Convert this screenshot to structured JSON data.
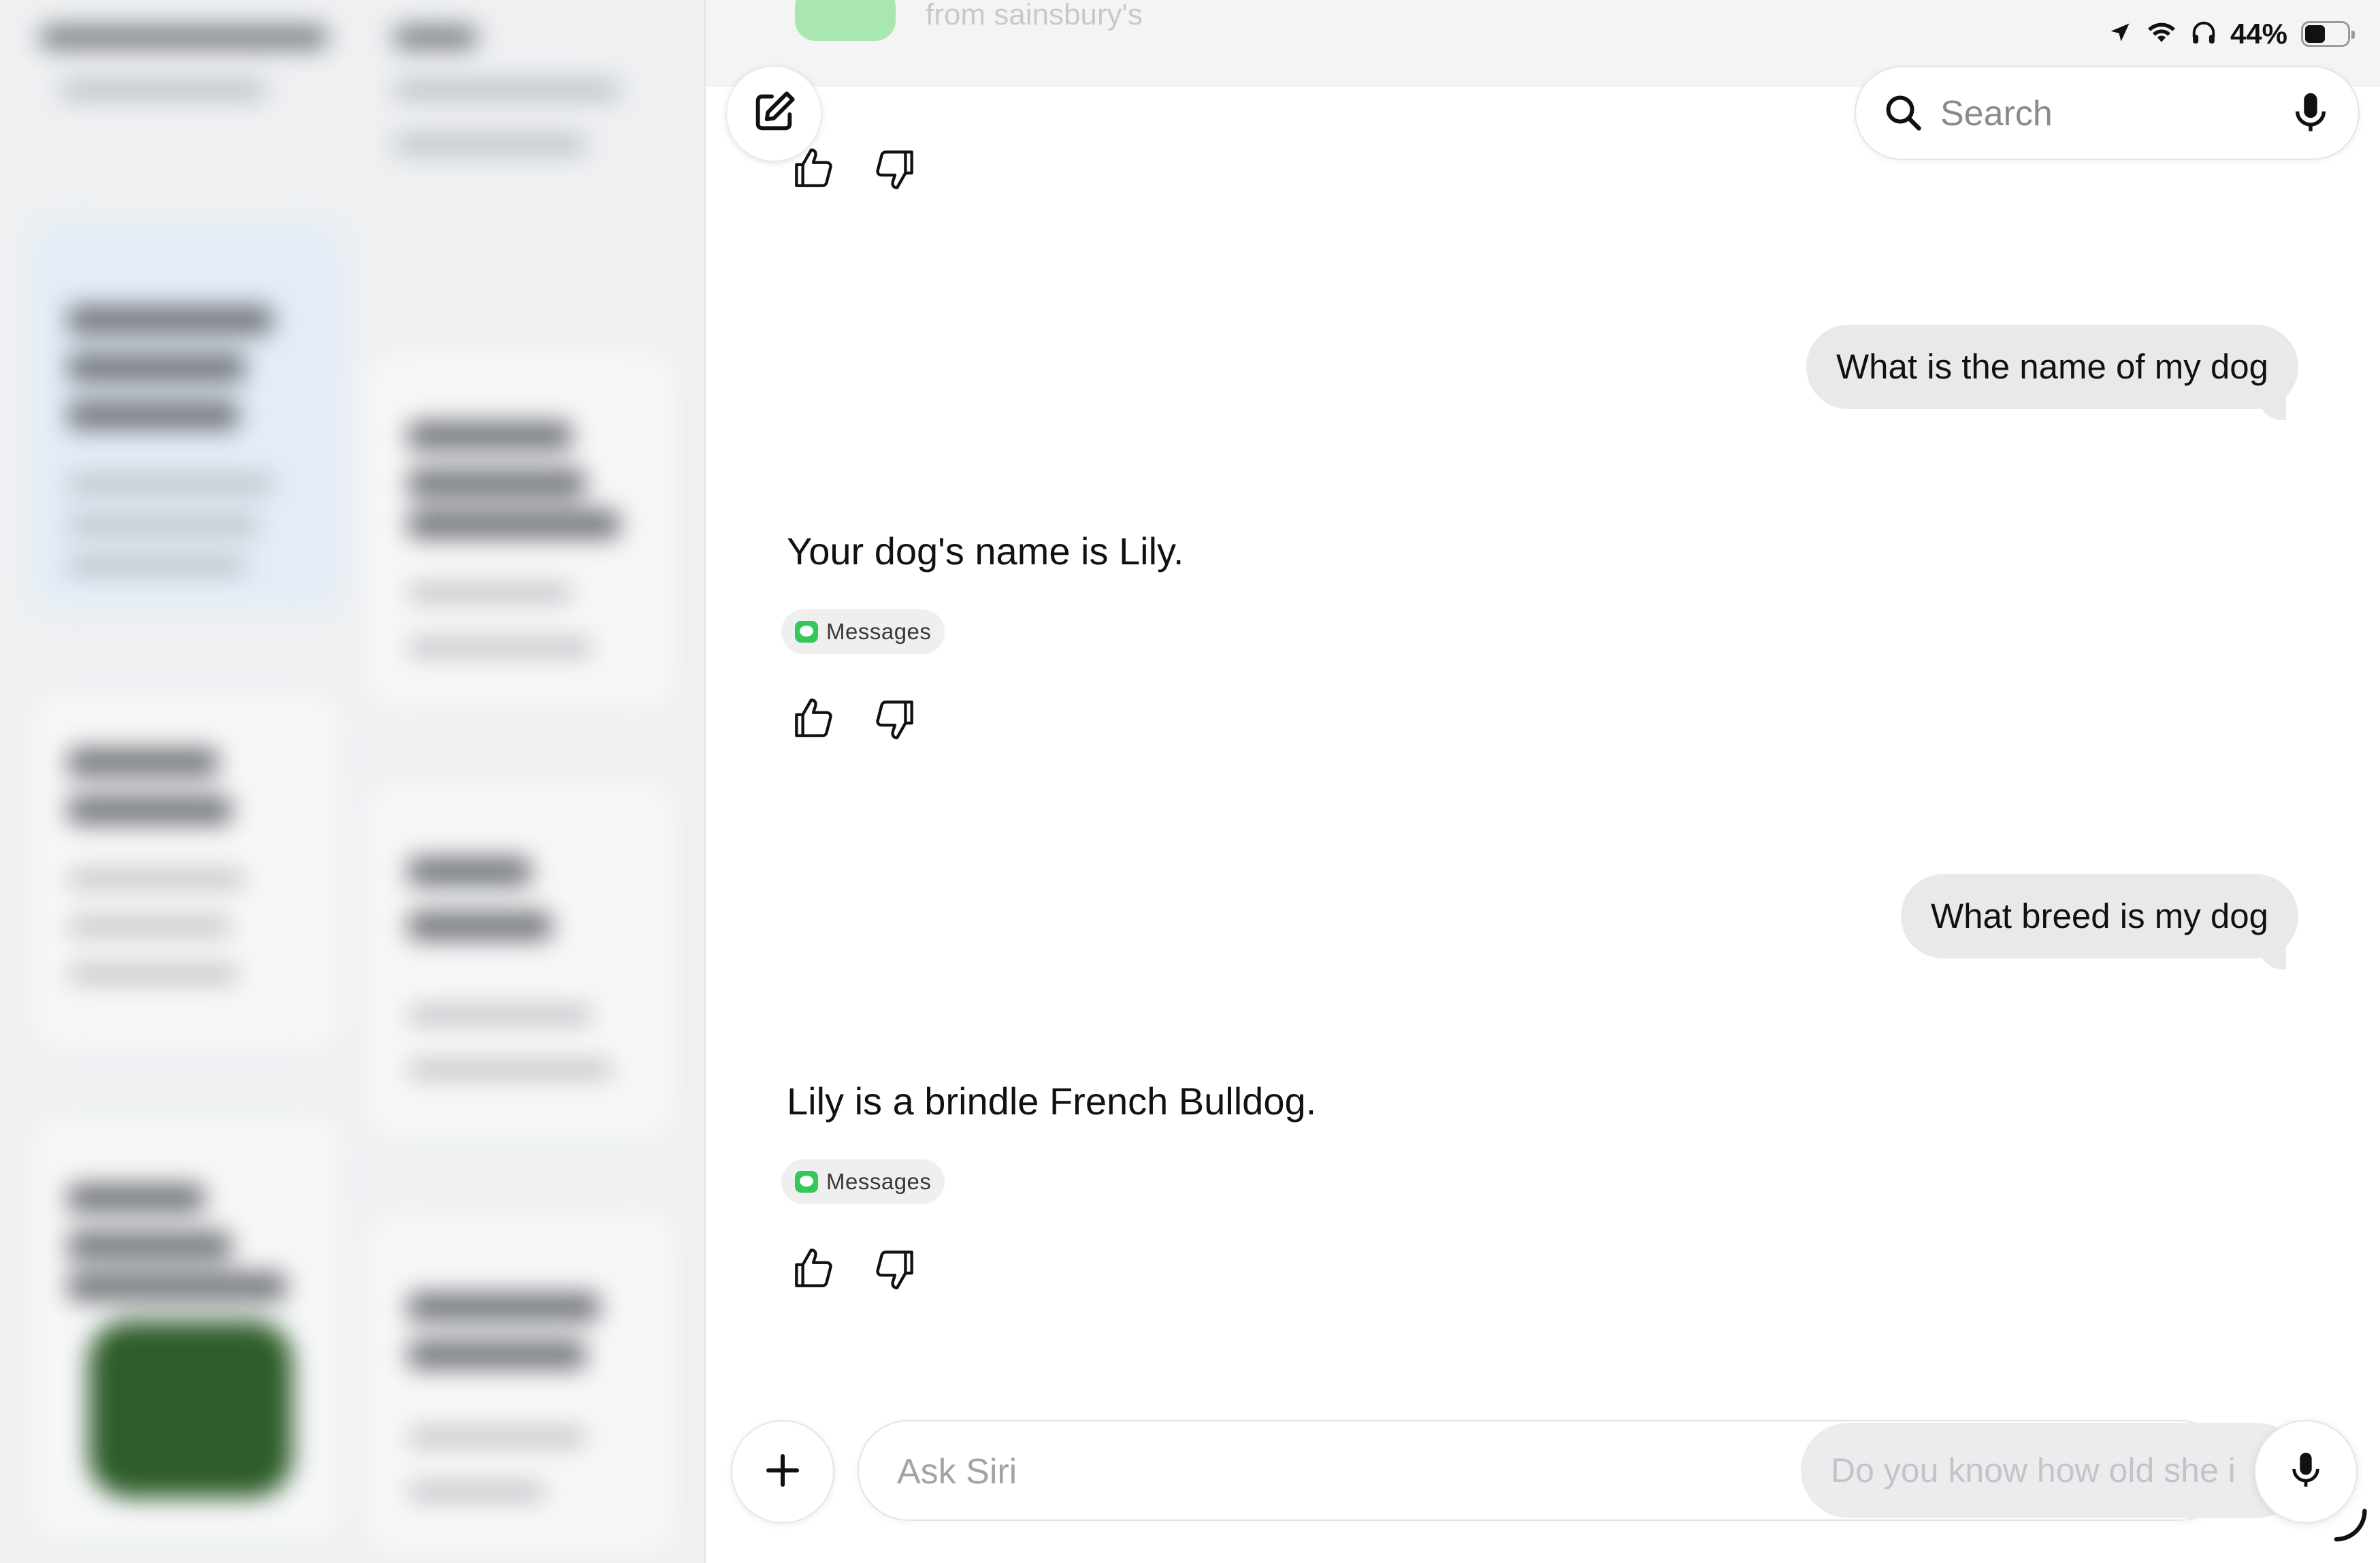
{
  "notification": {
    "text": "from sainsbury's"
  },
  "status_bar": {
    "battery_percent": "44%",
    "battery_level": 0.44
  },
  "search": {
    "placeholder": "Search"
  },
  "conversation": [
    {
      "role": "user",
      "text": "What is the name of my dog"
    },
    {
      "role": "assistant",
      "text": "Your dog's name is Lily.",
      "source": "Messages"
    },
    {
      "role": "user",
      "text": "What breed is my dog"
    },
    {
      "role": "assistant",
      "text": "Lily is a brindle French Bulldog.",
      "source": "Messages"
    }
  ],
  "composer": {
    "placeholder": "Ask Siri",
    "suggestion": "Do you know how old she i"
  },
  "colors": {
    "accent_green": "#34c759",
    "bubble_gray": "#e9e9eb"
  },
  "icons": [
    "compose-icon",
    "search-icon",
    "microphone-icon",
    "thumbs-up-icon",
    "thumbs-down-icon",
    "plus-icon",
    "location-arrow-icon",
    "wifi-icon",
    "headphones-icon",
    "battery-icon",
    "messages-app-icon"
  ]
}
